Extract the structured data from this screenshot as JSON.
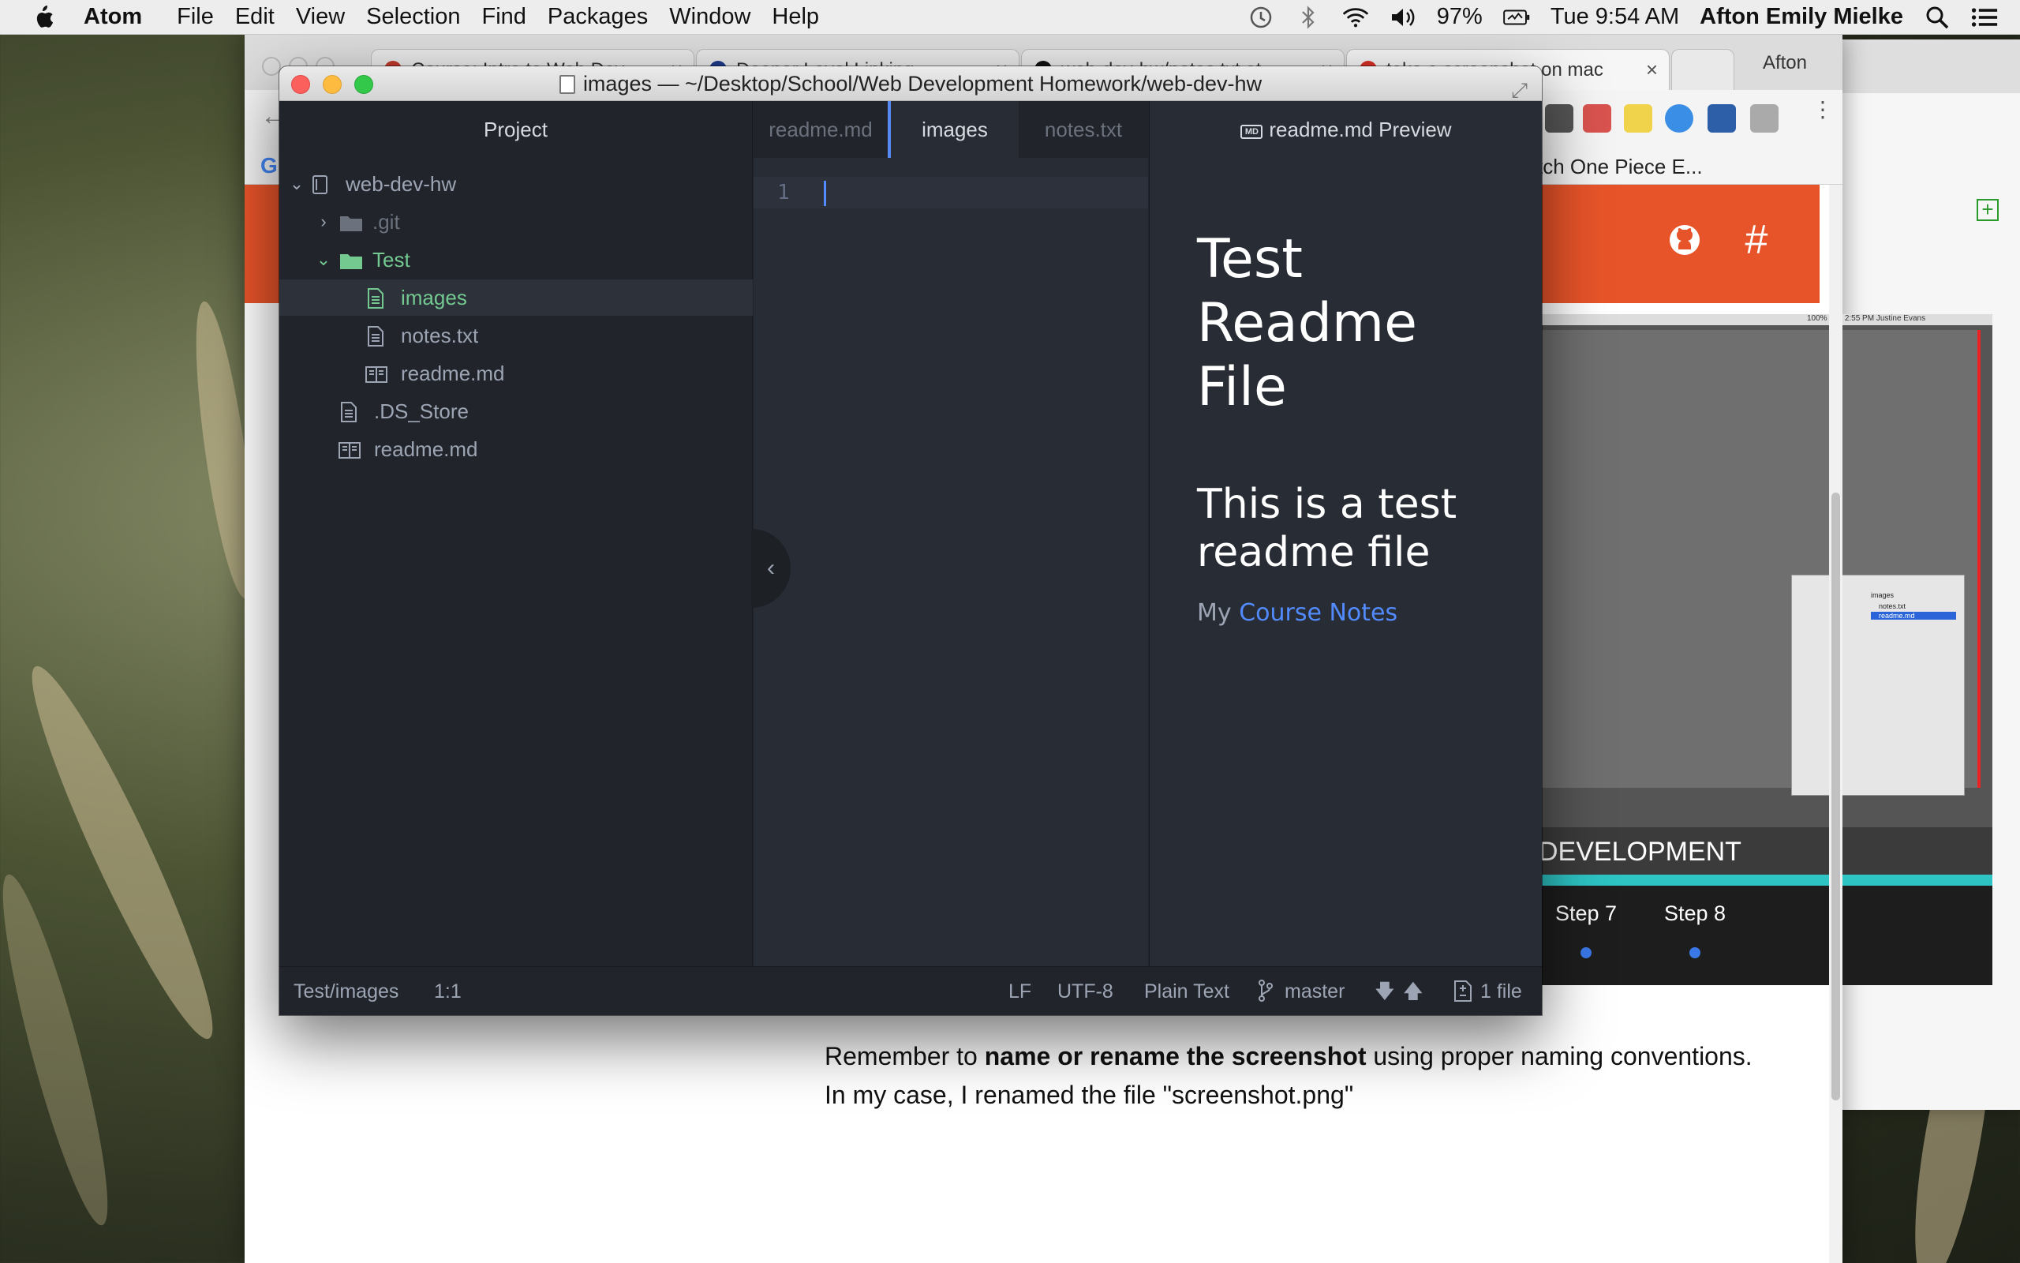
{
  "menubar": {
    "app": "Atom",
    "items": [
      "File",
      "Edit",
      "View",
      "Selection",
      "Find",
      "Packages",
      "Window",
      "Help"
    ],
    "battery": "97%",
    "clock": "Tue 9:54 AM",
    "user": "Afton Emily Mielke"
  },
  "browser": {
    "tabs": [
      {
        "title": "Course: Intro to Web Dev",
        "icon": "course-favicon",
        "color": "#c0392b"
      },
      {
        "title": "Deeper Level Linking",
        "icon": "m-favicon",
        "color": "#1e3a8a"
      },
      {
        "title": "web-dev-hw/notes.txt at",
        "icon": "github-favicon",
        "color": "#111111"
      },
      {
        "title": "take a screenshot on mac",
        "icon": "google-favicon",
        "color": "#d93025"
      }
    ],
    "profile": "Afton",
    "bookmark": "tch One Piece E...",
    "article": {
      "band_text": "DEVELOPMENT",
      "step7": "Step 7",
      "step8": "Step 8",
      "mini_menubar": "100% Tue 2:55 PM Justine Evans",
      "finder_items": [
        "images",
        "notes.txt",
        "readme.md"
      ],
      "text_before": "Remember to ",
      "text_bold": "name or rename the screenshot",
      "text_after": " using proper naming conventions. In my case, I renamed the file \"screenshot.png\""
    },
    "header_color": "#e8542a"
  },
  "atom": {
    "title": "images — ~/Desktop/School/Web Development Homework/web-dev-hw",
    "tree": {
      "header": "Project",
      "root": "web-dev-hw",
      "items": [
        {
          "label": ".git",
          "type": "folder-collapsed"
        },
        {
          "label": "Test",
          "type": "folder-expanded"
        },
        {
          "label": "images",
          "type": "file-selected"
        },
        {
          "label": "notes.txt",
          "type": "file"
        },
        {
          "label": "readme.md",
          "type": "markdown"
        },
        {
          "label": ".DS_Store",
          "type": "file"
        },
        {
          "label": "readme.md",
          "type": "markdown"
        }
      ]
    },
    "tabs": [
      "readme.md",
      "images",
      "notes.txt"
    ],
    "active_tab": "images",
    "line_number": "1",
    "preview": {
      "tab": "readme.md Preview",
      "badge": "MD",
      "h1": "Test Readme File",
      "h2": "This is a test readme file",
      "p_prefix": "My ",
      "p_link": "Course Notes"
    },
    "status": {
      "path": "Test/images",
      "position": "1:1",
      "line_ending": "LF",
      "encoding": "UTF-8",
      "grammar": "Plain Text",
      "branch": "master",
      "files": "1 file"
    },
    "colors": {
      "accent": "#568af2",
      "green": "#73c990",
      "bg": "#282c34"
    }
  }
}
